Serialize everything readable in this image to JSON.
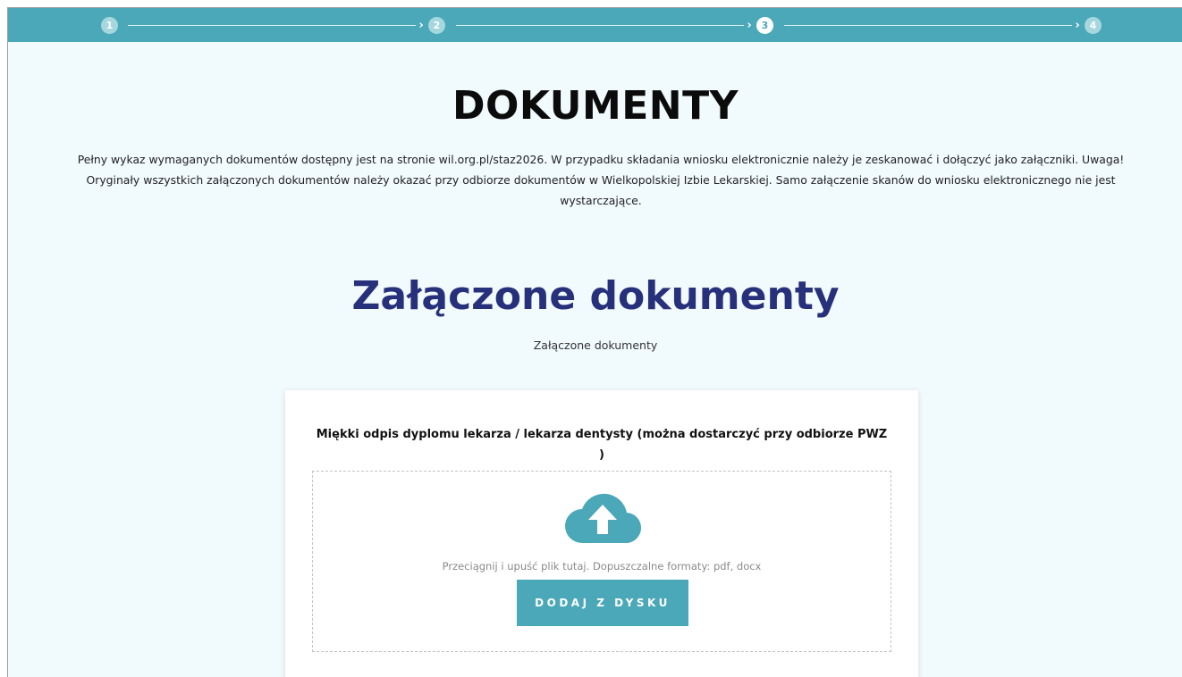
{
  "stepper": {
    "steps": [
      "1",
      "2",
      "3",
      "4"
    ],
    "active_step": 3,
    "arrow_glyph": "›",
    "color": "#4aa8b8"
  },
  "section": {
    "title": "DOKUMENTY",
    "description": "Pełny wykaz wymaganych dokumentów dostępny jest na stronie wil.org.pl/staz2026. W przypadku składania wniosku elektronicznie należy je zeskanować i dołączyć jako załączniki. Uwaga! Oryginały wszystkich załączonych dokumentów należy okazać przy odbiorze dokumentów w Wielkopolskiej Izbie Lekarskiej. Samo załączenie skanów do wniosku elektronicznego nie jest wystarczające."
  },
  "attachments": {
    "title": "Załączone dokumenty",
    "caption": "Załączone dokumenty",
    "title_color": "#27307a"
  },
  "upload_card": {
    "label": "Miękki odpis dyplomu lekarza / lekarza dentysty (można dostarczyć przy odbiorze PWZ )",
    "icon": "cloud-upload-icon",
    "hint": "Przeciągnij i upuść plik tutaj. Dopuszczalne formaty: pdf, docx",
    "button_label": "DODAJ Z DYSKU"
  }
}
